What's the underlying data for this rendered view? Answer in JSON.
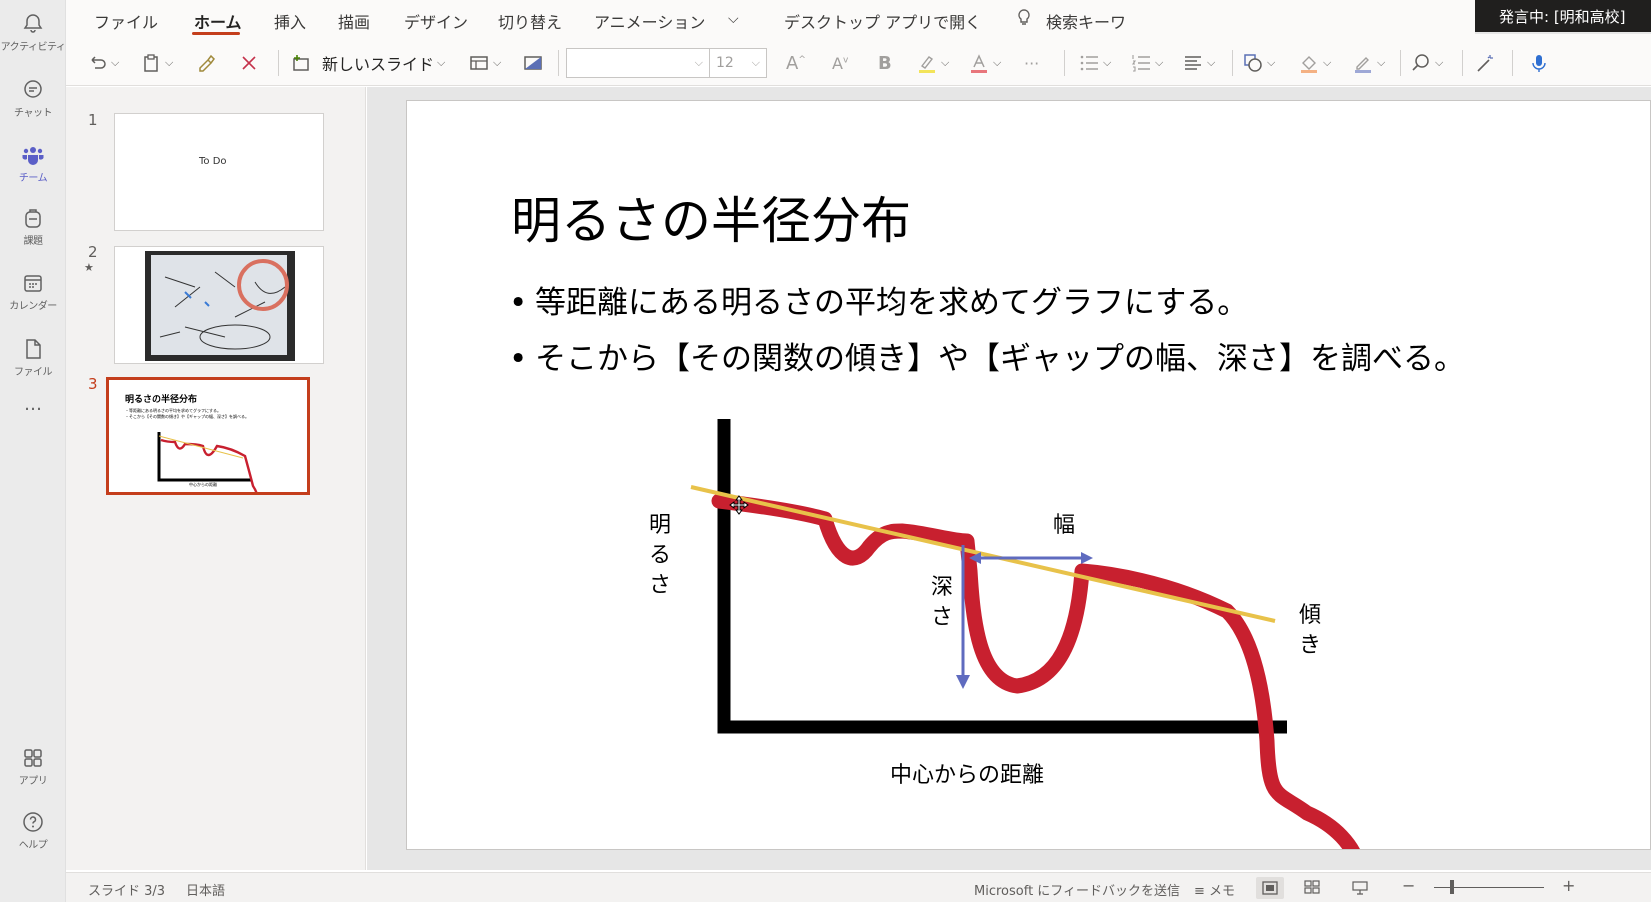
{
  "rail": {
    "items": [
      {
        "label": "アクティビティ",
        "icon": "bell-icon"
      },
      {
        "label": "チャット",
        "icon": "chat-icon"
      },
      {
        "label": "チーム",
        "icon": "teams-icon"
      },
      {
        "label": "課題",
        "icon": "backpack-icon"
      },
      {
        "label": "カレンダー",
        "icon": "calendar-icon"
      },
      {
        "label": "ファイル",
        "icon": "file-icon"
      },
      {
        "label": "…",
        "icon": "more-icon"
      },
      {
        "label": "アプリ",
        "icon": "apps-icon"
      },
      {
        "label": "ヘルプ",
        "icon": "help-icon"
      }
    ],
    "active_color": "#5b5fc7"
  },
  "ribbon": {
    "tabs": [
      "ファイル",
      "ホーム",
      "挿入",
      "描画",
      "デザイン",
      "切り替え",
      "アニメーション"
    ],
    "active_tab": "ホーム",
    "open_desktop": "デスクトップ アプリで開く",
    "search_label": "検索キーワ",
    "new_slide_label": "新しいスライド",
    "font_size": "12",
    "accent_color": "#c43e1c"
  },
  "banner": {
    "text": "発言中: [明和高校]"
  },
  "thumbnails": {
    "items": [
      {
        "number": "1",
        "text": "To Do"
      },
      {
        "number": "2",
        "star": "★"
      },
      {
        "number": "3",
        "title": "明るさの半径分布",
        "line1": "・等距離にある明るさの平均を求めてグラフにする。",
        "line2": "・そこから【その関数の傾き】や【ギャップの幅、深さ】を調べる。",
        "xlabel": "中心からの距離"
      }
    ],
    "selected": "3"
  },
  "slide": {
    "title": "明るさの半径分布",
    "bullets": [
      "等距離にある明るさの平均を求めてグラフにする。",
      "そこから【その関数の傾き】や【ギャップの幅、深さ】を調べる。"
    ],
    "bullet_mark": "•",
    "diagram": {
      "y_axis_label": "明るさ",
      "x_axis_label": "中心からの距離",
      "width_label": "幅",
      "depth_label": "深さ",
      "slope_label": "傾き",
      "curve_color": "#c8202f",
      "trend_color": "#e8c24a",
      "arrow_color": "#5f6bbf"
    }
  },
  "status": {
    "slide_counter": "スライド 3/3",
    "language": "日本語",
    "feedback": "Microsoft にフィードバックを送信",
    "notes": "メモ"
  }
}
